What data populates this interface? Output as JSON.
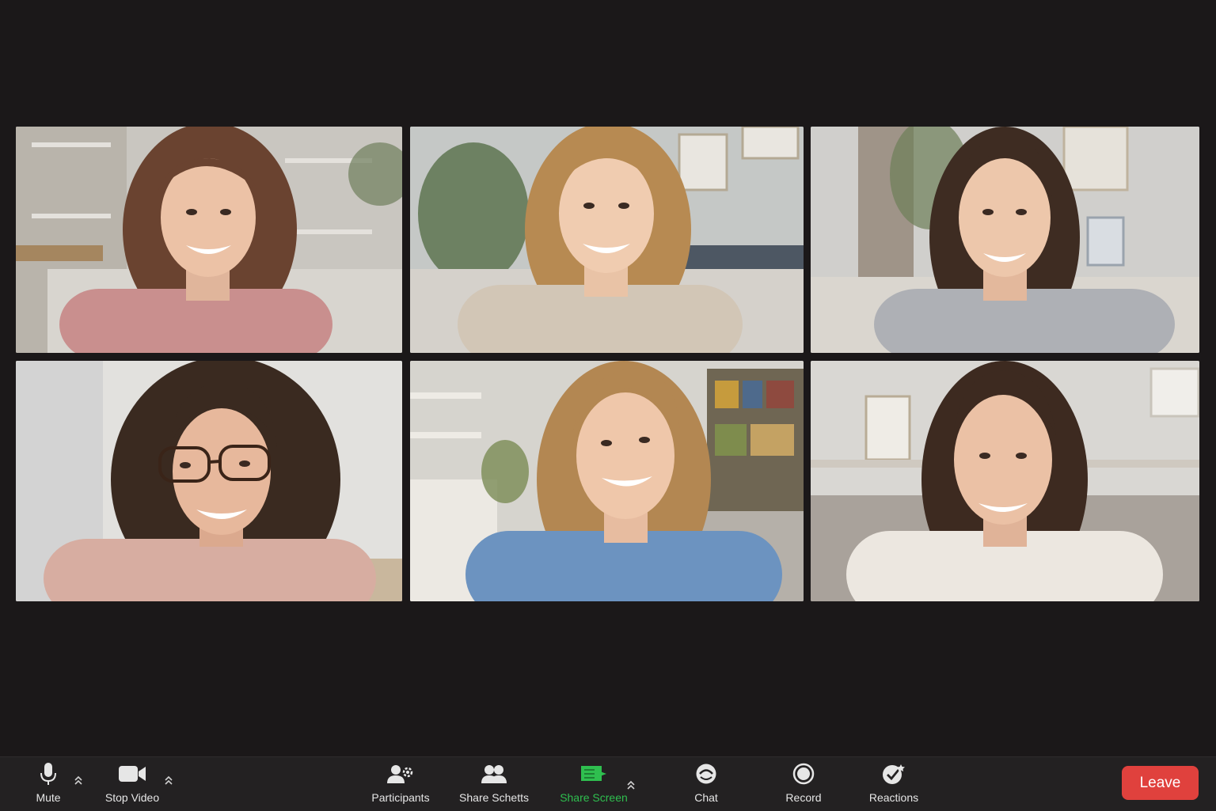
{
  "colors": {
    "background": "#1b1819",
    "toolbar": "#232122",
    "share_screen_accent": "#2fbf4f",
    "leave_button": "#e0413d",
    "label": "#e6e6e6"
  },
  "participants": [
    {
      "position": "row-1-col-1",
      "name": ""
    },
    {
      "position": "row-1-col-2",
      "name": ""
    },
    {
      "position": "row-1-col-3",
      "name": ""
    },
    {
      "position": "row-2-col-1",
      "name": ""
    },
    {
      "position": "row-2-col-2",
      "name": ""
    },
    {
      "position": "row-2-col-3",
      "name": ""
    }
  ],
  "toolbar": {
    "mute": {
      "label": "Mute",
      "icon": "microphone-icon"
    },
    "stop_video": {
      "label": "Stop Video",
      "icon": "video-camera-icon"
    },
    "participants": {
      "label": "Participants",
      "icon": "participants-icon"
    },
    "share_schetts": {
      "label": "Share Schetts",
      "icon": "people-icon"
    },
    "share_screen": {
      "label": "Share Screen",
      "icon": "share-screen-icon",
      "active": true
    },
    "chat": {
      "label": "Chat",
      "icon": "chat-icon"
    },
    "record": {
      "label": "Record",
      "icon": "record-icon"
    },
    "reactions": {
      "label": "Reactions",
      "icon": "reactions-icon"
    },
    "leave": {
      "label": "Leave"
    }
  }
}
